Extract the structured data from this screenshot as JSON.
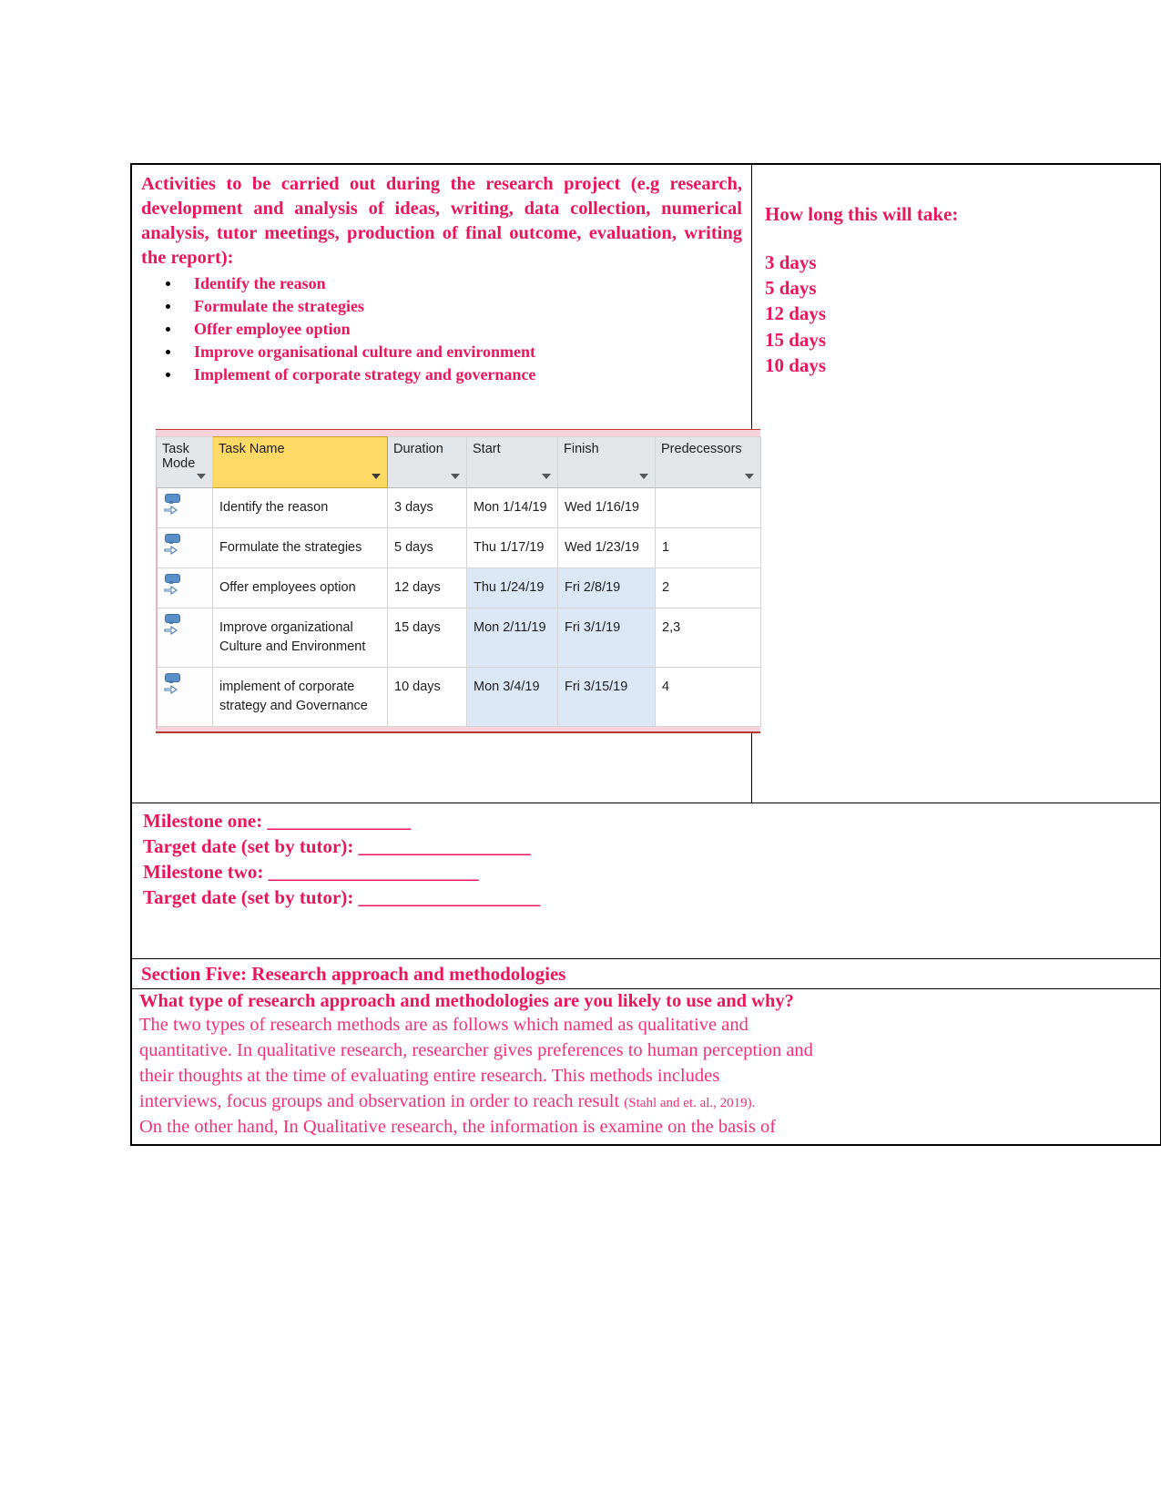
{
  "document": {
    "activities_heading": "Activities to be carried out during the research project (e.g research, development and analysis of ideas, writing, data collection, numerical analysis, tutor meetings, production of final outcome, evaluation, writing the report):",
    "activities": [
      "Identify the reason",
      "Formulate the strategies",
      "Offer employee option",
      "Improve organisational culture and environment",
      "Implement of corporate strategy and governance"
    ],
    "duration_heading": "How long this will take:",
    "durations": [
      "3 days",
      "5 days",
      "12 days",
      "15 days",
      "10 days"
    ],
    "milestones": [
      "Milestone one:  _______________",
      "Target date (set by tutor): __________________",
      "Milestone two: ______________________",
      "Target date (set by tutor): ___________________"
    ],
    "section_five_title": "Section Five: Research approach and methodologies",
    "question_heading": "What type of research approach and methodologies are you likely to use and why?",
    "body_lines": [
      "The two types of research methods are as follows which named as qualitative and",
      "quantitative. In qualitative research, researcher gives preferences to human perception and",
      "their thoughts at the time of evaluating entire research. This methods includes",
      "interviews, focus groups and observation in order to reach result ",
      "On the other hand, In Qualitative research, the information is examine on the basis of"
    ],
    "citation": "(Stahl and et. al.,  2019).",
    "accent_color": "#e8175d",
    "body_color": "#f2307a"
  },
  "msproject": {
    "columns": [
      "Task Mode",
      "Task Name",
      "Duration",
      "Start",
      "Finish",
      "Predecessors"
    ],
    "rows": [
      {
        "task_mode_icon": "manually-scheduled-icon",
        "name": "Identify the reason",
        "duration": "3 days",
        "start": "Mon 1/14/19",
        "finish": "Wed 1/16/19",
        "predecessors": ""
      },
      {
        "task_mode_icon": "manually-scheduled-icon",
        "name": "Formulate the strategies",
        "duration": "5 days",
        "start": "Thu 1/17/19",
        "finish": "Wed 1/23/19",
        "predecessors": "1"
      },
      {
        "task_mode_icon": "manually-scheduled-icon",
        "name": "Offer employees option",
        "duration": "12 days",
        "start": "Thu 1/24/19",
        "finish": "Fri 2/8/19",
        "predecessors": "2"
      },
      {
        "task_mode_icon": "manually-scheduled-icon",
        "name": "Improve organizational Culture and Environment",
        "duration": "15 days",
        "start": "Mon 2/11/19",
        "finish": "Fri 3/1/19",
        "predecessors": "2,3"
      },
      {
        "task_mode_icon": "manually-scheduled-icon",
        "name": "implement of corporate strategy and Governance",
        "duration": "10 days",
        "start": "Mon 3/4/19",
        "finish": "Fri 3/15/19",
        "predecessors": "4"
      }
    ],
    "header_highlight_color": "#ffd966",
    "selection_color": "#dce7f5"
  }
}
